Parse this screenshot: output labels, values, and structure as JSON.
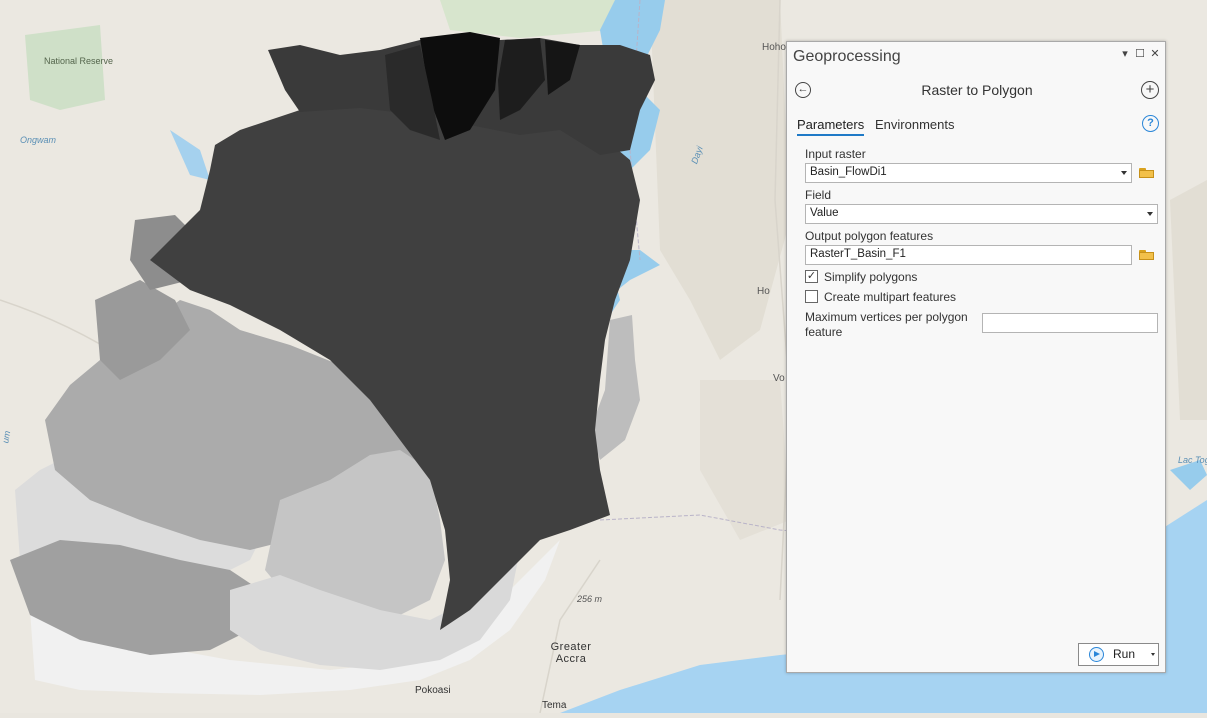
{
  "map": {
    "labels": {
      "national_reserve": "National Reserve",
      "ongwam": "Ongwam",
      "hohoe": "Hoho",
      "ho": "Ho",
      "volta": "Vo",
      "lac_togo": "Lac Toga",
      "elevation": "256 m",
      "greater_accra": "Greater Accra",
      "pokoasi": "Pokoasi",
      "tema": "Tema",
      "daye": "Dayi",
      "um": "um"
    },
    "colors": {
      "land": "#ebe8e1",
      "water": "#97ccec",
      "sea": "#a6d3f2",
      "park": "#cfe0c8"
    }
  },
  "geoprocessing": {
    "title": "Geoprocessing",
    "window_controls": {
      "pin": "▾",
      "restore": "☐",
      "close": "✕"
    },
    "tool_name": "Raster to Polygon",
    "back_icon": "back-arrow-icon",
    "add_icon": "plus-icon",
    "tabs": {
      "parameters": "Parameters",
      "environments": "Environments"
    },
    "help_icon": "?",
    "params": {
      "input_raster_label": "Input raster",
      "input_raster_value": "Basin_FlowDi1",
      "field_label": "Field",
      "field_value": "Value",
      "output_label": "Output polygon features",
      "output_value": "RasterT_Basin_F1",
      "simplify_label": "Simplify polygons",
      "simplify_checked": true,
      "simplify_mark": "✓",
      "multipart_label": "Create multipart features",
      "multipart_checked": false,
      "maxvert_label_line1": "Maximum vertices per polygon",
      "maxvert_label_line2": "feature",
      "maxvert_value": ""
    },
    "run_label": "Run",
    "accent_color": "#1f7ac7"
  }
}
